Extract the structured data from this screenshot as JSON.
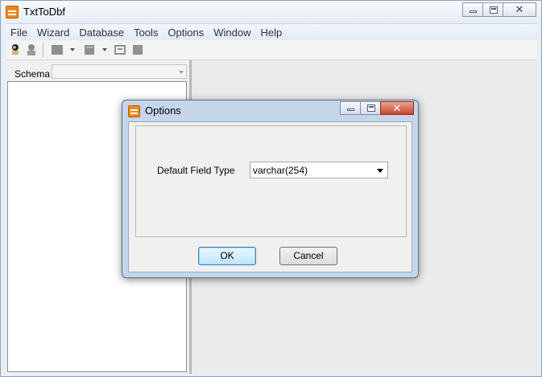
{
  "app": {
    "title": "TxtToDbf"
  },
  "menu": [
    "File",
    "Wizard",
    "Database",
    "Tools",
    "Options",
    "Window",
    "Help"
  ],
  "toolbar": {
    "icons": [
      "connect-icon",
      "disconnect-icon",
      "table-icon",
      "import-icon",
      "export-icon",
      "stop-icon"
    ]
  },
  "left_panel": {
    "schema_label": "Schema",
    "schema_value": ""
  },
  "dialog": {
    "title": "Options",
    "field_label": "Default Field Type",
    "field_value": "varchar(254)",
    "ok_label": "OK",
    "cancel_label": "Cancel"
  },
  "colors": {
    "accent": "#f08a1c",
    "ok_button": "#bee6fd"
  }
}
